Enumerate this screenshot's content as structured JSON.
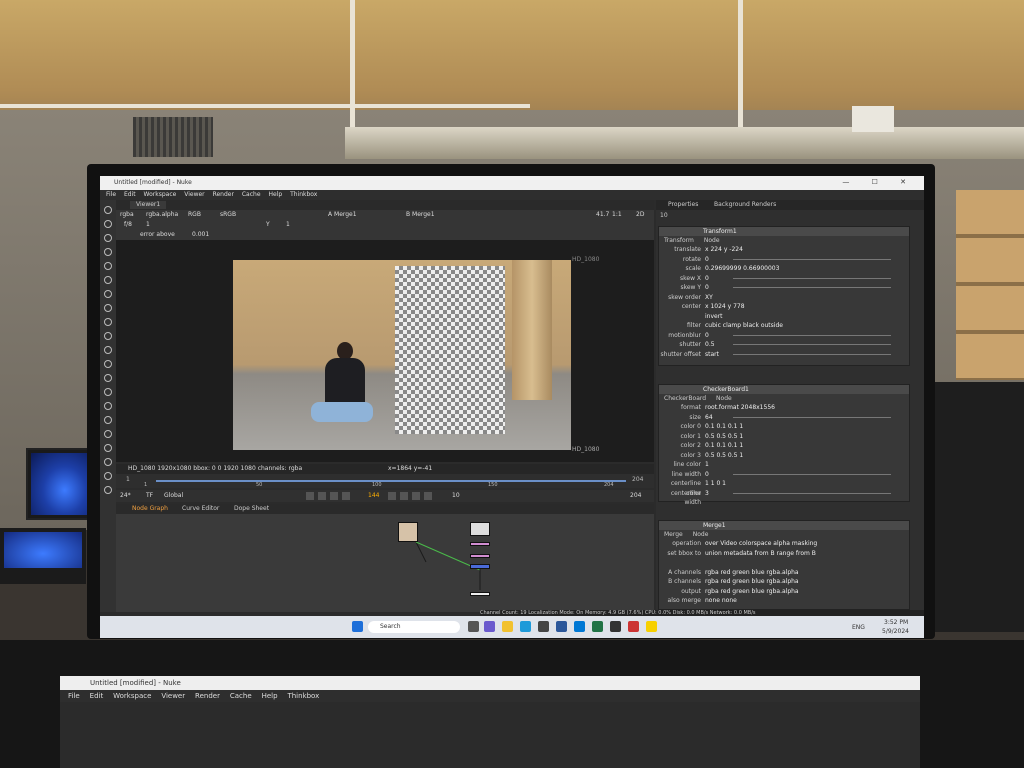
{
  "window": {
    "title": "Untitled [modified] - Nuke",
    "controls": "—  ☐  ✕"
  },
  "menu": [
    "File",
    "Edit",
    "Workspace",
    "Viewer",
    "Render",
    "Cache",
    "Help",
    "Thinkbox"
  ],
  "viewer": {
    "tab": "Viewer1",
    "channels": "rgba",
    "layer": "rgba.alpha",
    "colorspace": "RGB",
    "lut": "sRGB",
    "input_a": "A  Merge1",
    "input_b": "B  Merge1",
    "zoom": "41.7",
    "ratio": "1:1",
    "mode": "2D",
    "frame_field": "f/8",
    "gain": "1",
    "y_field": "Y",
    "gamma": "1",
    "error_mode": "error above",
    "error_value": "0.001",
    "format_label_top": "HD_1080",
    "format_label_bottom": "HD_1080",
    "status": "HD_1080 1920x1080  bbox: 0 0 1920 1080 channels: rgba",
    "coords": "x=1864 y=-41"
  },
  "timeline": {
    "start": "1",
    "ticks": [
      "1",
      "50",
      "100",
      "150",
      "204"
    ],
    "end": "204",
    "fps": "24*",
    "tf": "TF",
    "global": "Global",
    "current_frame": "144",
    "step": "10",
    "end_field": "204"
  },
  "node_tabs": [
    "Node Graph",
    "Curve Editor",
    "Dope Sheet"
  ],
  "properties": {
    "tabs": [
      "Properties",
      "Background Renders"
    ],
    "max_panels": "10",
    "transform": {
      "name": "Transform1",
      "tabs": [
        "Transform",
        "Node"
      ],
      "rows": [
        {
          "label": "translate",
          "value": "x 224    y -224"
        },
        {
          "label": "rotate",
          "value": "0"
        },
        {
          "label": "scale",
          "value": "0.29699999  0.66900003"
        },
        {
          "label": "skew X",
          "value": "0"
        },
        {
          "label": "skew Y",
          "value": "0"
        },
        {
          "label": "skew order",
          "value": "XY"
        },
        {
          "label": "center",
          "value": "x 1024    y 778"
        },
        {
          "label": "",
          "value": "invert"
        },
        {
          "label": "filter",
          "value": "cubic    clamp    black outside"
        },
        {
          "label": "motionblur",
          "value": "0"
        },
        {
          "label": "shutter",
          "value": "0.5"
        },
        {
          "label": "shutter offset",
          "value": "start"
        }
      ]
    },
    "checkerboard": {
      "name": "CheckerBoard1",
      "tabs": [
        "CheckerBoard",
        "Node"
      ],
      "rows": [
        {
          "label": "format",
          "value": "root.format 2048x1556"
        },
        {
          "label": "size",
          "value": "64"
        },
        {
          "label": "color 0",
          "value": "0.1   0.1   0.1   1"
        },
        {
          "label": "color 1",
          "value": "0.5   0.5   0.5   1"
        },
        {
          "label": "color 2",
          "value": "0.1   0.1   0.1   1"
        },
        {
          "label": "color 3",
          "value": "0.5   0.5   0.5   1"
        },
        {
          "label": "line color",
          "value": "1"
        },
        {
          "label": "line width",
          "value": "0"
        },
        {
          "label": "centerline color",
          "value": "1   1   0   1"
        },
        {
          "label": "centerline width",
          "value": "3"
        }
      ]
    },
    "merge": {
      "name": "Merge1",
      "tabs": [
        "Merge",
        "Node"
      ],
      "rows": [
        {
          "label": "operation",
          "value": "over    Video colorspace    alpha masking"
        },
        {
          "label": "set bbox to",
          "value": "union    metadata from  B    range from  B"
        },
        {
          "label": "",
          "value": ""
        },
        {
          "label": "A channels",
          "value": "rgba   red  green  blue   rgba.alpha"
        },
        {
          "label": "B channels",
          "value": "rgba   red  green  blue   rgba.alpha"
        },
        {
          "label": "output",
          "value": "rgba   red  green  blue   rgba.alpha"
        },
        {
          "label": "also merge",
          "value": "none      none"
        }
      ]
    }
  },
  "status_bar": "Channel Count: 19  Localization Mode: On  Memory: 4.9 GB (7.6%)  CPU: 0.0%  Disk: 0.0 MB/s  Network: 0.0 MB/s",
  "taskbar": {
    "search": "Search",
    "time": "3:52 PM",
    "date": "5/9/2024",
    "tray": "ENG"
  },
  "laptop": {
    "title": "Untitled [modified] - Nuke",
    "menu": [
      "File",
      "Edit",
      "Workspace",
      "Viewer",
      "Render",
      "Cache",
      "Help",
      "Thinkbox"
    ]
  }
}
